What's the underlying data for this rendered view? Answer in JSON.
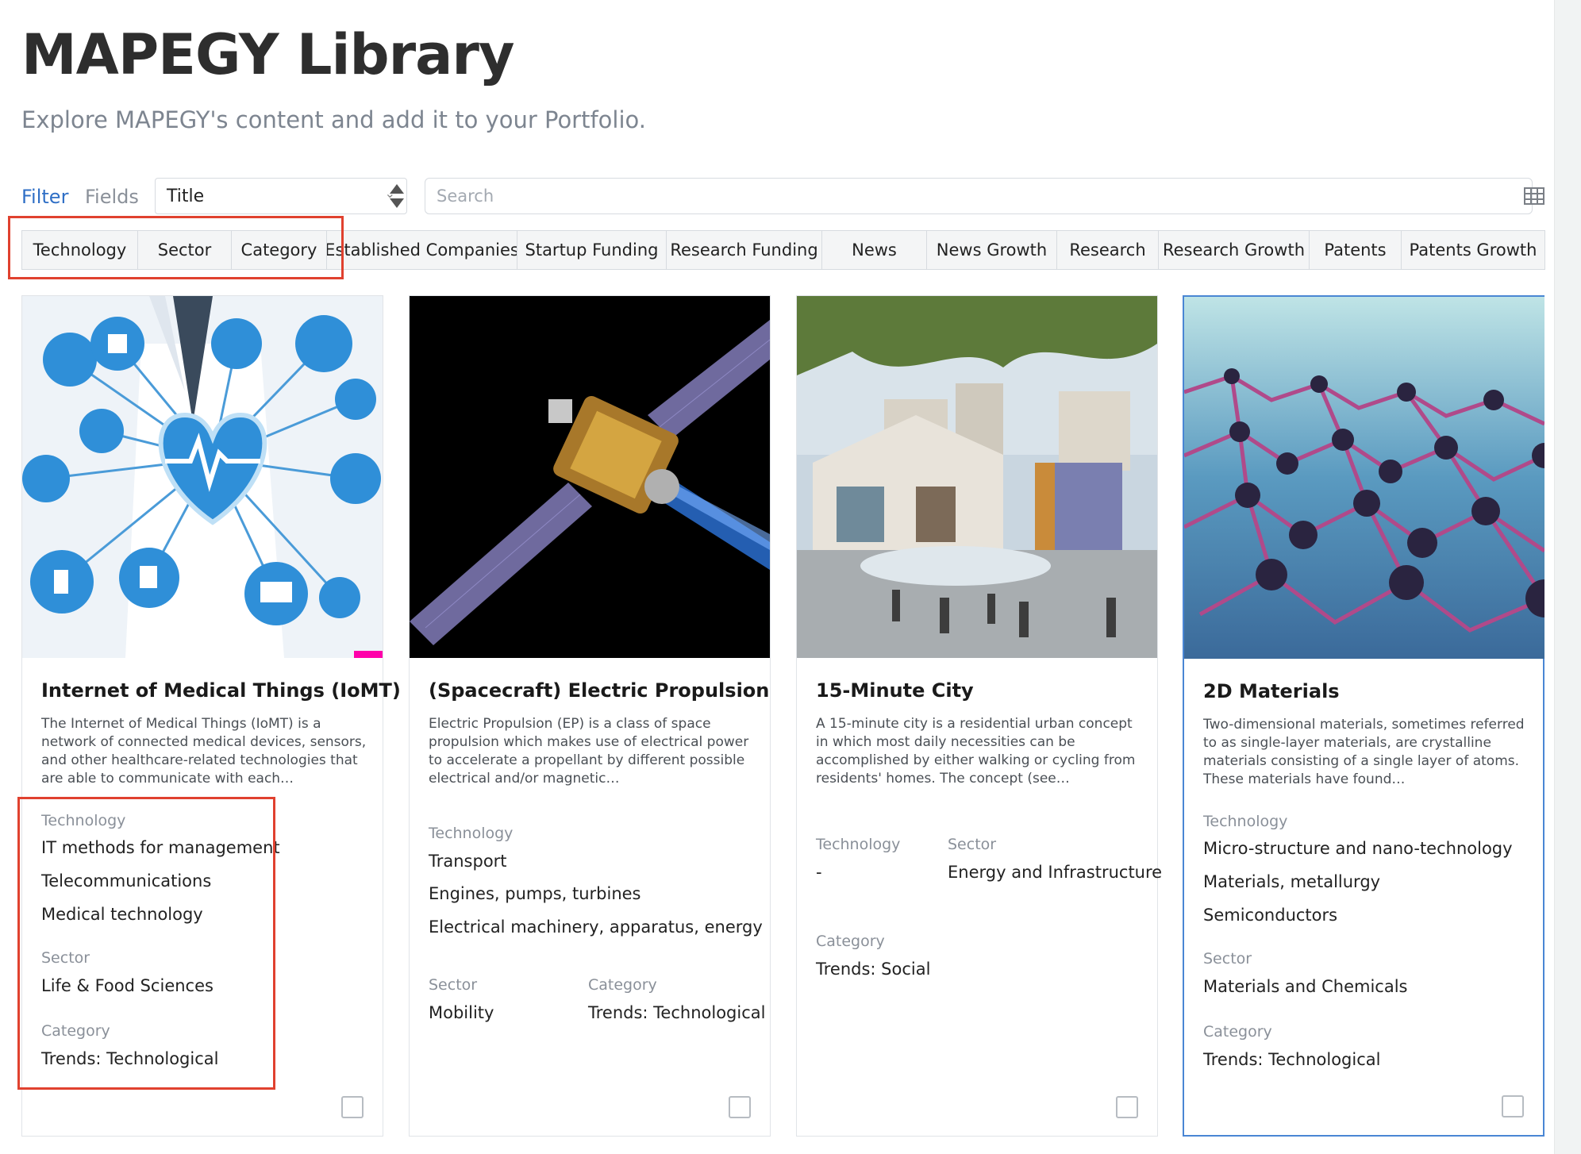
{
  "header": {
    "title": "MAPEGY Library",
    "subtitle": "Explore MAPEGY's content and add it to your Portfolio."
  },
  "toolbar": {
    "filter_label": "Filter",
    "fields_label": "Fields",
    "sort_field": "Title",
    "search_placeholder": "Search",
    "grid_icon": "grid-view-icon"
  },
  "field_tabs": [
    "Technology",
    "Sector",
    "Category",
    "Established Companies",
    "Startup Funding",
    "Research Funding",
    "News",
    "News Growth",
    "Research",
    "Research Growth",
    "Patents",
    "Patents Growth"
  ],
  "cards": [
    {
      "title": "Internet of Medical Things (IoMT)",
      "description": "The Internet of Medical Things (IoMT) is a network of connected medical devices, sensors, and other healthcare-related technologies that are able to communicate with each…",
      "technology_label": "Technology",
      "technology": [
        "IT methods for management",
        "Telecommunications",
        "Medical technology"
      ],
      "sector_label": "Sector",
      "sector": "Life & Food Sciences",
      "category_label": "Category",
      "category": "Trends: Technological"
    },
    {
      "title": "(Spacecraft) Electric Propulsion",
      "description": "Electric Propulsion (EP) is a class of space propulsion which makes use of electrical power to accelerate a propellant by different possible electrical and/or magnetic…",
      "technology_label": "Technology",
      "technology": [
        "Transport",
        "Engines, pumps, turbines",
        "Electrical machinery, apparatus, energy"
      ],
      "sector_label": "Sector",
      "sector": "Mobility",
      "category_label": "Category",
      "category": "Trends: Technological"
    },
    {
      "title": "15-Minute City",
      "description": "A 15-minute city is a residential urban concept in which most daily necessities can be accomplished by either walking or cycling from residents' homes. The concept (see…",
      "technology_label": "Technology",
      "technology": [
        "-"
      ],
      "sector_label": "Sector",
      "sector": "Energy and Infrastructure",
      "category_label": "Category",
      "category": "Trends: Social"
    },
    {
      "title": "2D Materials",
      "description": "Two-dimensional materials, sometimes referred to as single-layer materials, are crystalline materials consisting of a single layer of atoms. These materials have found…",
      "technology_label": "Technology",
      "technology": [
        "Micro-structure and nano-technology",
        "Materials, metallurgy",
        "Semiconductors"
      ],
      "sector_label": "Sector",
      "sector": "Materials and Chemicals",
      "category_label": "Category",
      "category": "Trends: Technological"
    }
  ],
  "colors": {
    "accent": "#2f6fc6",
    "highlight": "#e0412f",
    "selected_border": "#4a86d4"
  }
}
